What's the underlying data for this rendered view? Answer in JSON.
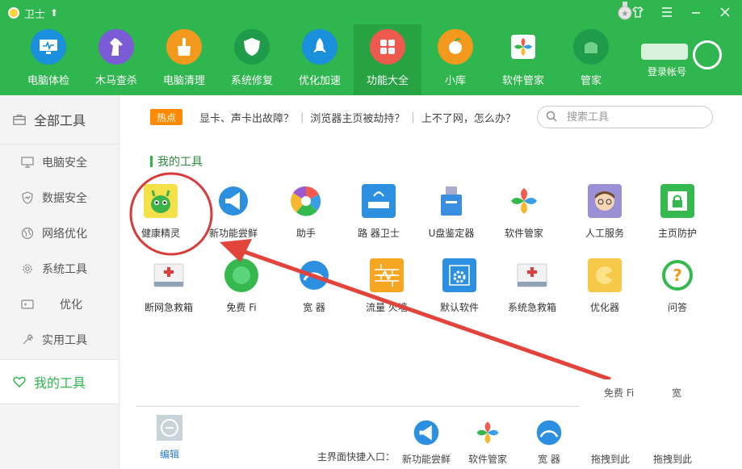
{
  "window": {
    "title": "卫士",
    "controls": [
      "shirt-icon",
      "menu-icon",
      "minimize-icon",
      "close-icon"
    ]
  },
  "nav": [
    {
      "label": "电脑体检",
      "icon": "monitor-icon",
      "color": "#1a8fdc"
    },
    {
      "label": "木马查杀",
      "icon": "horse-icon",
      "color": "#7b5bd6"
    },
    {
      "label": "电脑清理",
      "icon": "broom-icon",
      "color": "#f39a1e"
    },
    {
      "label": "系统修复",
      "icon": "shield-icon",
      "color": "#1e9c4a"
    },
    {
      "label": "优化加速",
      "icon": "rocket-icon",
      "color": "#1a8fdc"
    },
    {
      "label": "功能大全",
      "icon": "apps-icon",
      "color": "#ef5a4f"
    },
    {
      "label": "小库",
      "icon": "store-icon",
      "color": "#f39a1e"
    },
    {
      "label": "软件管家",
      "icon": "software-icon",
      "color": "#ffffff"
    },
    {
      "label": "管家",
      "icon": "phone-icon",
      "color": "#1e9c4a"
    }
  ],
  "login": {
    "label": "登录帐号"
  },
  "sidebar": {
    "header": "全部工具",
    "items": [
      {
        "label": "电脑安全",
        "icon": "pc-icon"
      },
      {
        "label": "数据安全",
        "icon": "data-shield-icon"
      },
      {
        "label": "网络优化",
        "icon": "globe-icon"
      },
      {
        "label": "系统工具",
        "icon": "gear-icon"
      },
      {
        "label": "优化",
        "icon": "gamepad-icon"
      },
      {
        "label": "实用工具",
        "icon": "wrench-icon"
      }
    ],
    "active": {
      "label": "我的工具",
      "icon": "heart-icon"
    }
  },
  "hot": {
    "badge": "热点",
    "links": [
      "显卡、声卡出故障？",
      "浏览器主页被劫持？",
      "上不了网，怎么办？"
    ]
  },
  "search": {
    "placeholder": "搜索工具"
  },
  "section_title": "我的工具",
  "tools_row1": [
    {
      "label": "健康精灵",
      "icon": "health-sprite-icon"
    },
    {
      "label": "新功能尝鲜",
      "icon": "megaphone-icon"
    },
    {
      "label": "助手",
      "icon": "pinwheel-icon"
    },
    {
      "label": "路  器卫士",
      "icon": "router-icon"
    },
    {
      "label": "U盘鉴定器",
      "icon": "usb-icon"
    },
    {
      "label": "软件管家",
      "icon": "software-icon"
    },
    {
      "label": "人工服务",
      "icon": "person-icon"
    },
    {
      "label": "主页防护",
      "icon": "lock-page-icon"
    }
  ],
  "tools_row2": [
    {
      "label": "断网急救箱",
      "icon": "firstaid-icon"
    },
    {
      "label": "免费   Fi",
      "icon": "wifi-icon"
    },
    {
      "label": "宽    器",
      "icon": "speed-icon"
    },
    {
      "label": "流量   火墙",
      "icon": "firewall-icon"
    },
    {
      "label": "默认软件",
      "icon": "default-app-icon"
    },
    {
      "label": "系统急救箱",
      "icon": "firstaid-icon"
    },
    {
      "label": "   优化器",
      "icon": "game-icon"
    },
    {
      "label": "  问答",
      "icon": "question-icon"
    }
  ],
  "bottom": {
    "edit_label": "编辑",
    "quick_label": "主界面快捷入口：",
    "quick_items": [
      {
        "label": "新功能尝鲜",
        "icon": "megaphone-icon"
      },
      {
        "label": "软件管家",
        "icon": "software-icon"
      },
      {
        "label": "宽    器",
        "icon": "speed-icon"
      },
      {
        "label": "拖拽到此",
        "icon": "empty-slot-icon"
      },
      {
        "label": "拖拽到此",
        "icon": "empty-slot-icon"
      }
    ],
    "overlay_labels": [
      "免费   Fi",
      "宽"
    ]
  }
}
